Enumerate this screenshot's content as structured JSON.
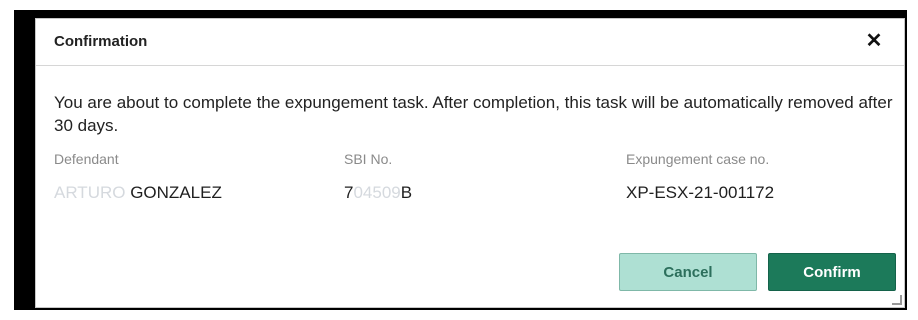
{
  "dialog": {
    "title": "Confirmation",
    "close_glyph": "✕",
    "message": "You are about to complete the expungement task. After completion, this task will be automatically removed after 30 days.",
    "fields": [
      {
        "label": "Defendant",
        "value_redacted": "ARTURO",
        "value": " GONZALEZ"
      },
      {
        "label": "SBI No.",
        "value_prefix": "7",
        "value_redacted": "04509",
        "value_suffix": "B"
      },
      {
        "label": "Expungement case no.",
        "value": "XP-ESX-21-001172"
      }
    ],
    "buttons": {
      "cancel": "Cancel",
      "confirm": "Confirm"
    }
  },
  "colors": {
    "cancel_bg": "#aee0d3",
    "confirm_bg": "#1c7a5a",
    "frame": "#000000"
  },
  "icons": [
    "close-icon"
  ]
}
